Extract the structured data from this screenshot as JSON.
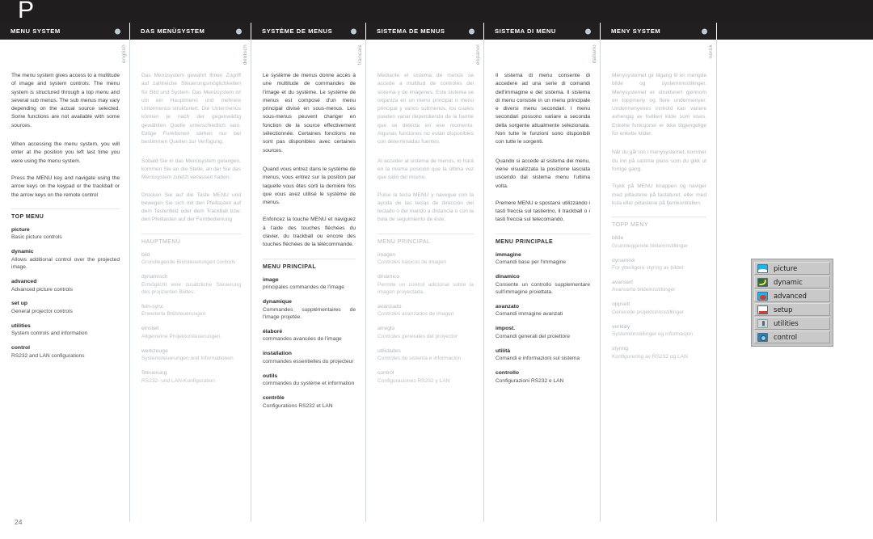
{
  "banner": {
    "logo": "P"
  },
  "page_number": "24",
  "languages": [
    {
      "key": "english",
      "tab_title": "MENU SYSTEM",
      "vertical_label": "english",
      "dim": false,
      "paragraphs": [
        "The menu system gives access to a multitude of image and system controls. The menu system is structured through a top menu and several sub menus. The sub menus may vary depending on the actual source selected. Some functions are not available with some sources.",
        "When accessing the menu system, you will enter at the position you left last time you were using the menu system.",
        "Press the MENU key and navigate using the arrow keys on the keypad or the trackball or the arrow keys on the remote control"
      ],
      "section_head": "TOP MENU",
      "entries": [
        {
          "term": "picture",
          "desc": "Basic picture controls"
        },
        {
          "term": "dynamic",
          "desc": "Allows additional control over the projected image."
        },
        {
          "term": "advanced",
          "desc": "Advanced picture controls"
        },
        {
          "term": "set up",
          "desc": "General projector controls"
        },
        {
          "term": "utilities",
          "desc": "System controls and information"
        },
        {
          "term": "control",
          "desc": "RS232 and LAN configurations"
        }
      ]
    },
    {
      "key": "deutsch",
      "tab_title": "DAS MENÜSYSTEM",
      "vertical_label": "deutsch",
      "dim": true,
      "paragraphs": [
        "Das Menüsystem gewährt Ihnen Zugriff auf zahlreiche Steuerungsmöglichkeiten für Bild und System. Das Menüsystem ist um ein Hauptmenü und mehrere Untermenüs strukturiert. Die Untermenüs können je nach der gegenwärtig gewählten Quelle unterschiedlich sein. Einige Funktionen stehen nur bei bestimmen Quellen zur Verfügung.",
        "Sobald Sie in das Menüsystem gelangen, kommen Sie an die Stelle, an der Sie das Menüsystem zuletzt verlassen haben.",
        "Drücken Sie auf die Taste MENU und bewegen Sie sich mit den Pfeiltasten auf dem Tastenfeld oder dem Trackball bzw. den Pfeiltasten auf der Fernbedienung"
      ],
      "section_head": "HAUPTMENÜ",
      "entries": [
        {
          "term": "bild",
          "desc": "Grundlegende Bildsteuerungen controls"
        },
        {
          "term": "dynamisch",
          "desc": "Ermöglicht eine zusätzliche Steuerung des projizierten Bildes."
        },
        {
          "term": "fein-sync",
          "desc": "Erweiterte Bildsteuerungen"
        },
        {
          "term": "einstell",
          "desc": "Allgemeine Projektorsteuerungen"
        },
        {
          "term": "werkzeuge",
          "desc": "Systemsteuerungen und Informationen"
        },
        {
          "term": "Steuerung",
          "desc": "RS232- und LAN-Konfiguration"
        }
      ]
    },
    {
      "key": "francais",
      "tab_title": "SYSTÈME DE MENUS",
      "vertical_label": "francais",
      "dim": false,
      "paragraphs": [
        "Le système de menus donne accès à une multitude de commandes de l'image et du système. Le système de menus est composé d'un menu principal divisé en sous-menus. Les sous-menus peuvent changer en fonction de la source effectivement sélectionnée. Certaines fonctions ne sont pas disponibles avec certaines sources.",
        "Quand vous entrez dans le système de menus, vous entrez sur la position par laquelle vous êtes sorti la dernière fois que vous avez utilisé le système de menus.",
        "Enfoncez la touche MENU et naviguez à l'aide des touches fléchées du clavier, du trackball ou encore des touches fléchées de la télécommande."
      ],
      "section_head": "MENU PRINCIPAL",
      "entries": [
        {
          "term": "image",
          "desc": "principales commandes de l'image"
        },
        {
          "term": "dynamique",
          "desc": "Commandes supplémentaires de l'image projetée."
        },
        {
          "term": "élaboré",
          "desc": "commandes avancées de l'image"
        },
        {
          "term": "installation",
          "desc": "commandes essentielles du projecteur"
        },
        {
          "term": "outils",
          "desc": "commandes du système et information"
        },
        {
          "term": "contrôle",
          "desc": "Configurations RS232 et LAN"
        }
      ]
    },
    {
      "key": "espanol",
      "tab_title": "SISTEMA DE MENUS",
      "vertical_label": "espanol",
      "dim": true,
      "paragraphs": [
        "Mediante el sistema de menús se accede a multitud de controles del sistema y de imágenes. Este sistema se organiza en un menú principal o menú principal y varios submenús, los cuales pueden variar dependiendo de la fuente que se detecte en ese momento. Algunas funciones no están disponibles con determinadas fuentes.",
        "Al acceder al sistema de menús, lo hará en la misma posición que la última vez que salió del mismo.",
        "Pulse la tecla MENU y navegue con la ayuda de las teclas de dirección del teclado o del mando a distancia o con la bola de seguimiento de éste."
      ],
      "section_head": "MENÚ PRINCIPAL",
      "entries": [
        {
          "term": "imagen",
          "desc": "Controles básicos de imagen"
        },
        {
          "term": "dinámico",
          "desc": "Permite un control adicional sobre la imagen proyectada."
        },
        {
          "term": "avanzado",
          "desc": "Controles avanzados de imagen"
        },
        {
          "term": "arreglo",
          "desc": "Controles generales del proyector"
        },
        {
          "term": "utilidades",
          "desc": "Controles de sistema e información"
        },
        {
          "term": "control",
          "desc": "Configuraciones RS232 y LAN"
        }
      ]
    },
    {
      "key": "italiano",
      "tab_title": "SISTEMA DI MENU",
      "vertical_label": "italiano",
      "dim": false,
      "paragraphs": [
        "Il sistema di menu consente di accedere ad una serie di comandi dell'immagine e del sistema. Il sistema di menu consiste in un menu principale e diversi menu secondari. I menu secondari possono variare a seconda della sorgente attualmente selezionata. Non tutte le funzioni sono disponibili con tutte le sorgenti.",
        "Quando si accede al sistema dei menu, viene visualizzata la posizione lasciata uscendo dal sistema menu l'ultima volta.",
        "Premere MENU e spostarsi utilizzando i tasti freccia sul tastierino, il trackball o i tasti freccia sul telecomando."
      ],
      "section_head": "MENU PRINCIPALE",
      "entries": [
        {
          "term": "immagine",
          "desc": "Comandi base per l'immagine"
        },
        {
          "term": "dinamico",
          "desc": "Consente un controllo supplementare sull'immagine proiettata."
        },
        {
          "term": "avanzato",
          "desc": "Comandi immagine avanzati"
        },
        {
          "term": "impost.",
          "desc": "Comandi generali del proiettore"
        },
        {
          "term": "utilità",
          "desc": "Comandi e informazioni sul sistema"
        },
        {
          "term": "controllo",
          "desc": "Configurazioni RS232 e LAN"
        }
      ]
    },
    {
      "key": "norsk",
      "tab_title": "MENY SYSTEM",
      "vertical_label": "norsk",
      "dim": true,
      "paragraphs": [
        "Menysystemet gir tilgang til en mengde bilde og systeminnstillinger. Menysystemet er strukturert gjennom en toppmeny og flere undermenyer. Undermenyenes innhold kan variere avhengig av hvilken kilde som vises. Enkelte funksjoner er ikke tilgjengelige for enkelte kilder.",
        "Når du går inn i menysystemet, kommer du inn på samme plass som du gikk ut forrige gang.",
        "Trykk på MENU knappen og naviger med piltastene på tastaturet, eller med kula eller piltastene på fjernkontrollen."
      ],
      "section_head": "TOPP MENY",
      "entries": [
        {
          "term": "bilde",
          "desc": "Grunnleggende bildeinnstillinger"
        },
        {
          "term": "dynamisk",
          "desc": "For ytterligere styring av bildet"
        },
        {
          "term": "avansert",
          "desc": "Avanserte bildeinnstillinger"
        },
        {
          "term": "oppsett",
          "desc": "Generelle projektorinnstillinger"
        },
        {
          "term": "verktøy",
          "desc": "Systeminnstillinger og informasjon"
        },
        {
          "term": "styring",
          "desc": "Konfigurering av RS232 og LAN"
        }
      ]
    }
  ],
  "osd_menu": {
    "items": [
      {
        "label": "picture",
        "icon": "picture-icon"
      },
      {
        "label": "dynamic",
        "icon": "dynamic-icon"
      },
      {
        "label": "advanced",
        "icon": "advanced-icon"
      },
      {
        "label": "setup",
        "icon": "setup-icon"
      },
      {
        "label": "utilities",
        "icon": "utilities-icon"
      },
      {
        "label": "control",
        "icon": "control-icon"
      }
    ]
  },
  "colors": {
    "banner_bg": "#1f1d1d",
    "tab_dot": "#b9cdd4",
    "rule": "#cfd9dd",
    "dim_text": "#b0b6ba"
  }
}
